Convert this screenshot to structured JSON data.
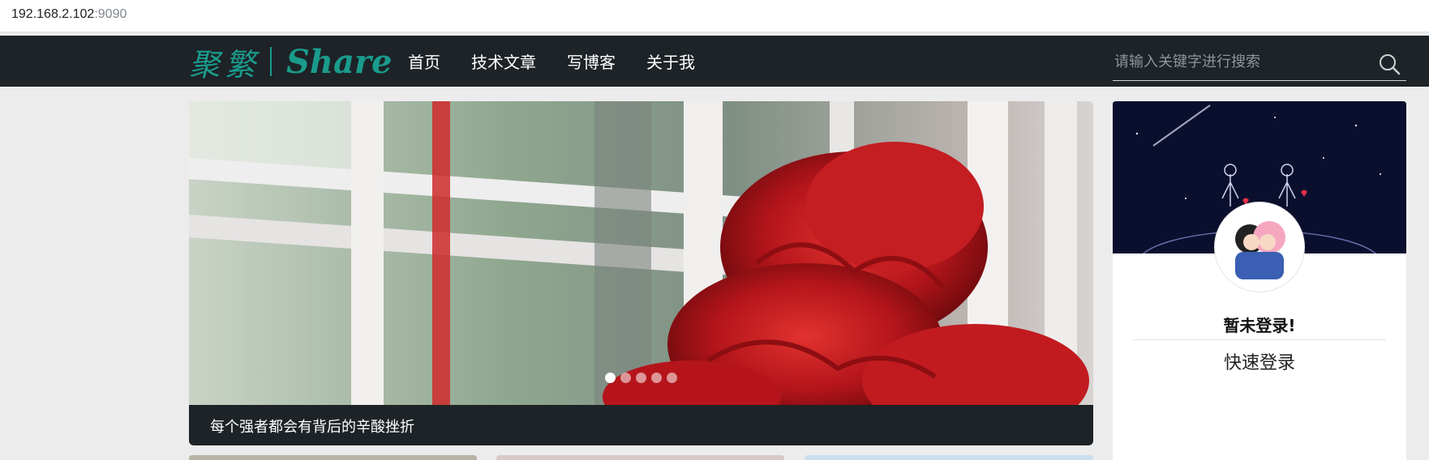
{
  "browser": {
    "url_host": "192.168.2.102",
    "url_port": ":9090"
  },
  "header": {
    "logo_cn": "聚繁",
    "logo_en": "Share",
    "nav": [
      "首页",
      "技术文章",
      "写博客",
      "关于我"
    ],
    "search_placeholder": "请输入关键字进行搜索"
  },
  "carousel": {
    "caption": "每个强者都会有背后的辛酸挫折",
    "slide_count": 5,
    "active_index": 0
  },
  "sidebar": {
    "status": "暂未登录!",
    "login_link": "快速登录"
  },
  "colors": {
    "accent": "#1a9b8c",
    "navbar": "#1d2327",
    "background": "#ececec"
  }
}
